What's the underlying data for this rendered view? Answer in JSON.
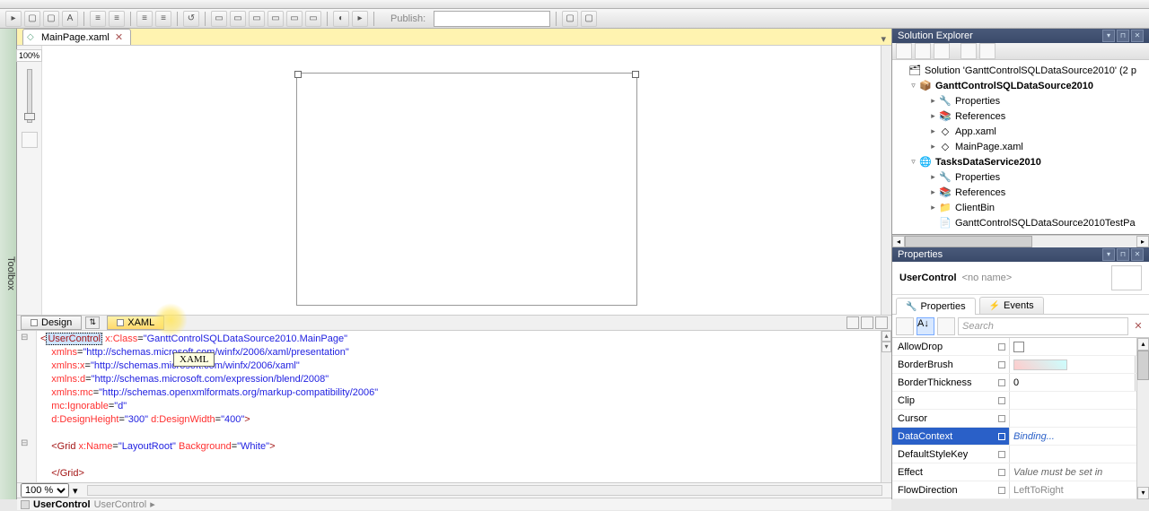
{
  "toolbar": {
    "publish_label": "Publish:"
  },
  "toolbox_label": "Toolbox",
  "doc_tab": {
    "title": "MainPage.xaml"
  },
  "designer": {
    "zoom_pct": "100%",
    "status_zoom": "100 %"
  },
  "split_tabs": {
    "design": "Design",
    "xaml": "XAML",
    "tooltip": "XAML"
  },
  "xaml_lines": {
    "l1_open": "<",
    "l1_uc": "UserControl",
    "l1_attr": " x:Class",
    "l1_eq": "=",
    "l1_val": "\"GanttControlSQLDataSource2010.MainPage\"",
    "l2_attr": "xmlns",
    "l2_val": "\"http://schemas.microsoft.com/winfx/2006/xaml/presentation\"",
    "l3_attr": "xmlns:x",
    "l3_val": "\"http://schemas.microsoft.com/winfx/2006/xaml\"",
    "l4_attr": "xmlns:d",
    "l4_val": "\"http://schemas.microsoft.com/expression/blend/2008\"",
    "l5_attr": "xmlns:mc",
    "l5_val": "\"http://schemas.openxmlformats.org/markup-compatibility/2006\"",
    "l6_attr": "mc:Ignorable",
    "l6_val": "\"d\"",
    "l7_a1": "d:DesignHeight",
    "l7_v1": "\"300\"",
    "l7_a2": " d:DesignWidth",
    "l7_v2": "\"400\"",
    "l7_close": ">",
    "l9_open": "<",
    "l9_tag": "Grid",
    "l9_a1": " x:Name",
    "l9_v1": "\"LayoutRoot\"",
    "l9_a2": " Background",
    "l9_v2": "\"White\"",
    "l9_close": ">",
    "l11": "</Grid>"
  },
  "breadcrumb": {
    "b1": "UserControl",
    "b2": "UserControl"
  },
  "solution_explorer": {
    "title": "Solution Explorer",
    "root": "Solution 'GanttControlSQLDataSource2010' (2 p",
    "proj1": "GanttControlSQLDataSource2010",
    "p1_properties": "Properties",
    "p1_references": "References",
    "p1_app": "App.xaml",
    "p1_main": "MainPage.xaml",
    "proj2": "TasksDataService2010",
    "p2_properties": "Properties",
    "p2_references": "References",
    "p2_clientbin": "ClientBin",
    "p2_testpa": "GanttControlSQLDataSource2010TestPa"
  },
  "properties": {
    "title": "Properties",
    "object": "UserControl",
    "noname": "<no name>",
    "tab_props": "Properties",
    "tab_events": "Events",
    "search_placeholder": "Search",
    "rows": [
      {
        "name": "AllowDrop",
        "value": "",
        "type": "checkbox"
      },
      {
        "name": "BorderBrush",
        "value": "",
        "type": "brush"
      },
      {
        "name": "BorderThickness",
        "value": "0",
        "type": "text-dd"
      },
      {
        "name": "Clip",
        "value": "",
        "type": "empty"
      },
      {
        "name": "Cursor",
        "value": "",
        "type": "empty"
      },
      {
        "name": "DataContext",
        "value": "Binding...",
        "type": "selected"
      },
      {
        "name": "DefaultStyleKey",
        "value": "",
        "type": "empty"
      },
      {
        "name": "Effect",
        "value": "Value must be set in",
        "type": "readonly"
      },
      {
        "name": "FlowDirection",
        "value": "LeftToRight",
        "type": "text"
      }
    ]
  }
}
